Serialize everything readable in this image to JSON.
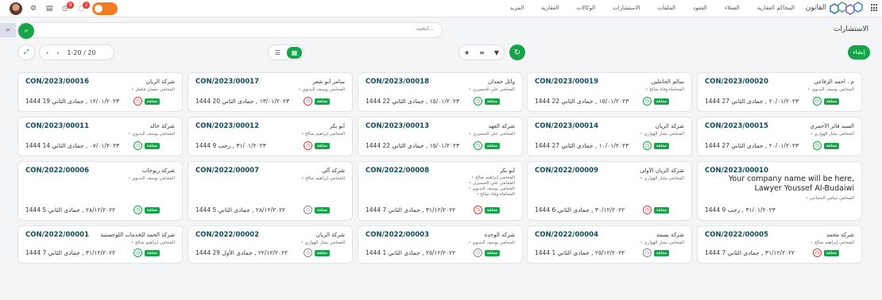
{
  "topbar": {
    "brand": "القانون",
    "menu": [
      "المحاكم العقارية",
      "العملاء",
      "العقود",
      "الملفات",
      "الاستشارات",
      "الوكالات",
      "العقارية",
      "المزيد"
    ],
    "badges": {
      "activity": "9",
      "messages": "2"
    },
    "icons": [
      "avatar",
      "settings-icon",
      "document-icon",
      "clock-icon",
      "chat-icon",
      "toggle"
    ]
  },
  "page": {
    "title": "الاستشارات",
    "search_placeholder": "ابحث...",
    "pager": "1-20 / 20",
    "create_label": "إنشاء"
  },
  "colors": {
    "accent": "#16a34a",
    "code": "#0f4c5c",
    "danger": "#e53935",
    "toggle": "#f47c20"
  },
  "cards": [
    {
      "code": "CON/2023/00020",
      "client": "م . أحمد الرفاعي",
      "lawyers": [
        "المحامي يوسف البديوي"
      ],
      "date": "٢٠/٠١/٢٠٢٣ , جمادى الثاني 27 1444",
      "status": "green",
      "tag": "معلقة"
    },
    {
      "code": "CON/2023/00019",
      "client": "سالم الحاملين",
      "lawyers": [
        "المحاماة وفاء صالح"
      ],
      "date": "١٥/٠١/٢٠٢٣ , جمادى الثاني 22 1444",
      "status": "green",
      "tag": "معلقة"
    },
    {
      "code": "CON/2023/00018",
      "client": "وائل حمدان",
      "lawyers": [
        "المحامي علي الحسيري"
      ],
      "date": "١٥/٠١/٢٠٢٣ , جمادى الثاني 22 1444",
      "status": "green",
      "tag": "معلقة"
    },
    {
      "code": "CON/2023/00017",
      "client": "سامر أبو شعر",
      "lawyers": [
        "المحامي يوسف البديوي"
      ],
      "date": "١٣/٠١/٢٠٢٣ , جمادى الثاني 20 1444",
      "status": "red",
      "tag": "معلقة"
    },
    {
      "code": "CON/2023/00016",
      "client": "شركة الريان",
      "lawyers": [
        "المحامي حسان فاضل"
      ],
      "date": "١٢/٠١/٢٠٢٣ , جمادى الثاني 19 1444",
      "status": "red",
      "tag": "معلقة"
    },
    {
      "code": "CON/2023/00015",
      "client": "السيد فائز الأحمري",
      "lawyers": [
        "المحامي بشار الهواري"
      ],
      "date": "٢٠/٠١/٢٠٢٣ , جمادى الثاني 27 1444",
      "status": "green",
      "tag": "معلقة"
    },
    {
      "code": "CON/2023/00014",
      "client": "شركة الريان",
      "lawyers": [
        "المحامي بشار الهواري"
      ],
      "date": "١٠/٠١/٢٠٢٣ , جمادى الثاني 27 1444",
      "status": "green",
      "tag": "معلقة"
    },
    {
      "code": "CON/2023/00013",
      "client": "شركة العهد",
      "lawyers": [
        "المحامي علي الحسيري"
      ],
      "date": "١٥/٠١/٢٠٢٣ , جمادى الثاني 22 1444",
      "status": "green",
      "tag": "معلقة"
    },
    {
      "code": "CON/2023/00012",
      "client": "أبو بكر",
      "lawyers": [
        "المحامي إبراهيم صالح"
      ],
      "date": "٣١/٠١/٢٠٢٣ , رجب 9 1444",
      "status": "red",
      "tag": "معلقة"
    },
    {
      "code": "CON/2023/00011",
      "client": "شركة خالد",
      "lawyers": [
        "المحامي يوسف البديوي"
      ],
      "date": "٠٧/٠١/٢٠٢٣ , جمادى الثاني 14 1444",
      "status": "green",
      "tag": "معلقة"
    },
    {
      "code": "CON/2023/00010",
      "client": "",
      "big": "Your company name will be here, Lawyer Youssef Al-Budaiwi",
      "lawyers": [
        "المحامي سامي الحجاجي"
      ],
      "date": "٣١/٠١/٢٠٢٣ , رجب 9 1444",
      "status": "",
      "tag": ""
    },
    {
      "code": "CON/2022/00009",
      "client": "شركة الريان الأولى",
      "lawyers": [
        "المحامي بشار الهواري"
      ],
      "date": "٣٠/١٢/٢٠٢٢ , جمادى الثاني 6 1444",
      "status": "red",
      "tag": "معلقة"
    },
    {
      "code": "CON/2022/00008",
      "client": "أبو بكر",
      "lawyers": [
        "المحامي إبراهيم صالح",
        "المحامي علي الحسيري",
        "المحامي يوسف البديوي",
        "المحاماة وفاء صالح"
      ],
      "date": "٣١/١٢/٢٠٢٢ , جمادى الثاني 7 1444",
      "status": "red",
      "tag": "معلقة"
    },
    {
      "code": "CON/2022/00007",
      "client": "شركة آلي",
      "lawyers": [
        "المحامي إبراهيم صالح"
      ],
      "date": "٢٨/١٢/٢٠٢٢ , جمادى الثاني 5 1444",
      "status": "grey",
      "tag": "معلقة"
    },
    {
      "code": "CON/2022/00006",
      "client": "شركة زيوجات",
      "lawyers": [
        "المحامي يوسف البديوي"
      ],
      "date": "٢٨/١٢/٢٠٢٢ , جمادى الثاني 5 1444",
      "status": "green",
      "tag": "معلقة"
    },
    {
      "code": "CON/2022/00005",
      "client": "شركة محمد",
      "lawyers": [
        "المحامي إبراهيم صالح"
      ],
      "date": "٣١/١٢/٢٠٢٢ , جمادى الثاني 7 1444",
      "status": "red",
      "tag": "معلقة"
    },
    {
      "code": "CON/2022/00004",
      "client": "شركة بسمة",
      "lawyers": [
        "المحامي بشار الهواري"
      ],
      "date": "٢٥/١٢/٢٠٢٢ , جمادى الثاني 1 1444",
      "status": "grey",
      "tag": "معلقة"
    },
    {
      "code": "CON/2022/00003",
      "client": "شركة الوحدة",
      "lawyers": [
        "المحامي يوسف البديوي"
      ],
      "date": "٢٥/١٢/٢٠٢٢ , جمادى الثاني 1 1444",
      "status": "grey",
      "tag": "معلقة"
    },
    {
      "code": "CON/2022/00002",
      "client": "شركة الريان",
      "lawyers": [
        "المحامي بشار الهواري"
      ],
      "date": "٢٢/١٢/٢٠٢٢ , جمادى الأول 29 1444",
      "status": "grey",
      "tag": "معلقة"
    },
    {
      "code": "CON/2022/00001",
      "client": "شركة الحمد للخدمات اللوجستية",
      "lawyers": [
        "المحامي إبراهيم صالح"
      ],
      "date": "٣١/١٢/٢٠٢٢ , جمادى الثاني 7 1444",
      "status": "green",
      "tag": "معلقة"
    }
  ]
}
